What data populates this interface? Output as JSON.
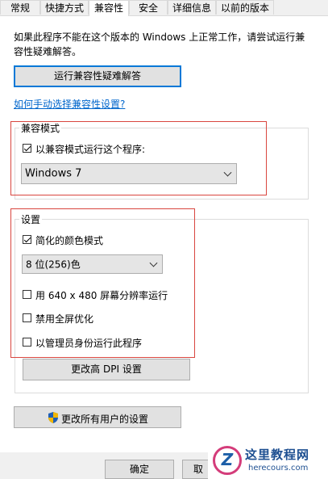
{
  "tabs": [
    "常规",
    "快捷方式",
    "兼容性",
    "安全",
    "详细信息",
    "以前的版本"
  ],
  "intro_text": "如果此程序不能在这个版本的 Windows 上正常工作，请尝试运行兼容性疑难解答。",
  "troubleshoot_button": "运行兼容性疑难解答",
  "manual_link": "如何手动选择兼容性设置?",
  "compat_mode": {
    "legend": "兼容模式",
    "checkbox_label": "以兼容模式运行这个程序:",
    "checked": true,
    "selected_os": "Windows 7"
  },
  "settings": {
    "legend": "设置",
    "reduced_color": {
      "label": "简化的颜色模式",
      "checked": true
    },
    "color_depth": "8 位(256)色",
    "res_640": {
      "label": "用 640 x 480 屏幕分辨率运行",
      "checked": false
    },
    "disable_fullscreen": {
      "label": "禁用全屏优化",
      "checked": false
    },
    "run_as_admin": {
      "label": "以管理员身份运行此程序",
      "checked": false
    },
    "dpi_button": "更改高 DPI 设置"
  },
  "all_users_button": "更改所有用户的设置",
  "ok_button": "确定",
  "cancel_button_partial": "取",
  "watermark": {
    "title": "这里教程网",
    "url": "herecours.com"
  },
  "colors": {
    "accent": "#0078d7",
    "highlight_box": "#d9463f",
    "link": "#0066cc"
  }
}
